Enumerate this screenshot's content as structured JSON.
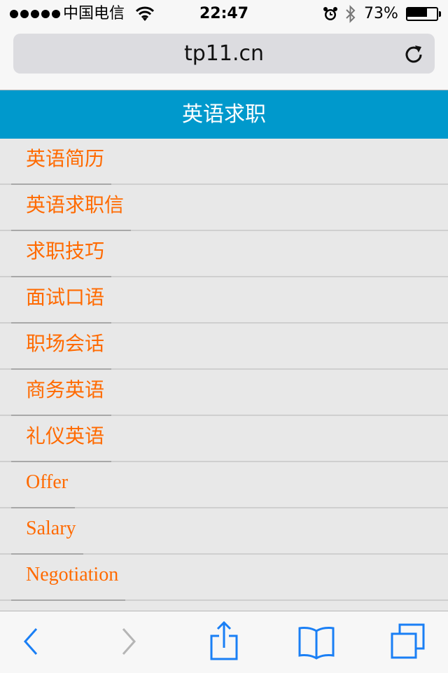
{
  "status_bar": {
    "carrier": "中国电信",
    "time": "22:47",
    "battery_percent": "73%",
    "battery_level": 0.73,
    "icons": [
      "signal-dots-icon",
      "wifi-icon",
      "alarm-icon",
      "bluetooth-icon",
      "battery-icon"
    ]
  },
  "browser": {
    "url": "tp11.cn",
    "reload_icon": "reload-icon"
  },
  "header": {
    "title": "英语求职",
    "background": "#0099cc"
  },
  "menu": {
    "accent": "#ff6a00",
    "items": [
      {
        "label": "英语简历"
      },
      {
        "label": "英语求职信"
      },
      {
        "label": "求职技巧"
      },
      {
        "label": "面试口语"
      },
      {
        "label": "职场会话"
      },
      {
        "label": "商务英语"
      },
      {
        "label": "礼仪英语"
      },
      {
        "label": "Offer"
      },
      {
        "label": "Salary"
      },
      {
        "label": "Negotiation"
      }
    ]
  },
  "toolbar": {
    "icons": [
      "back-icon",
      "forward-icon",
      "share-icon",
      "bookmarks-icon",
      "tabs-icon"
    ],
    "accent": "#1a7ff5"
  }
}
